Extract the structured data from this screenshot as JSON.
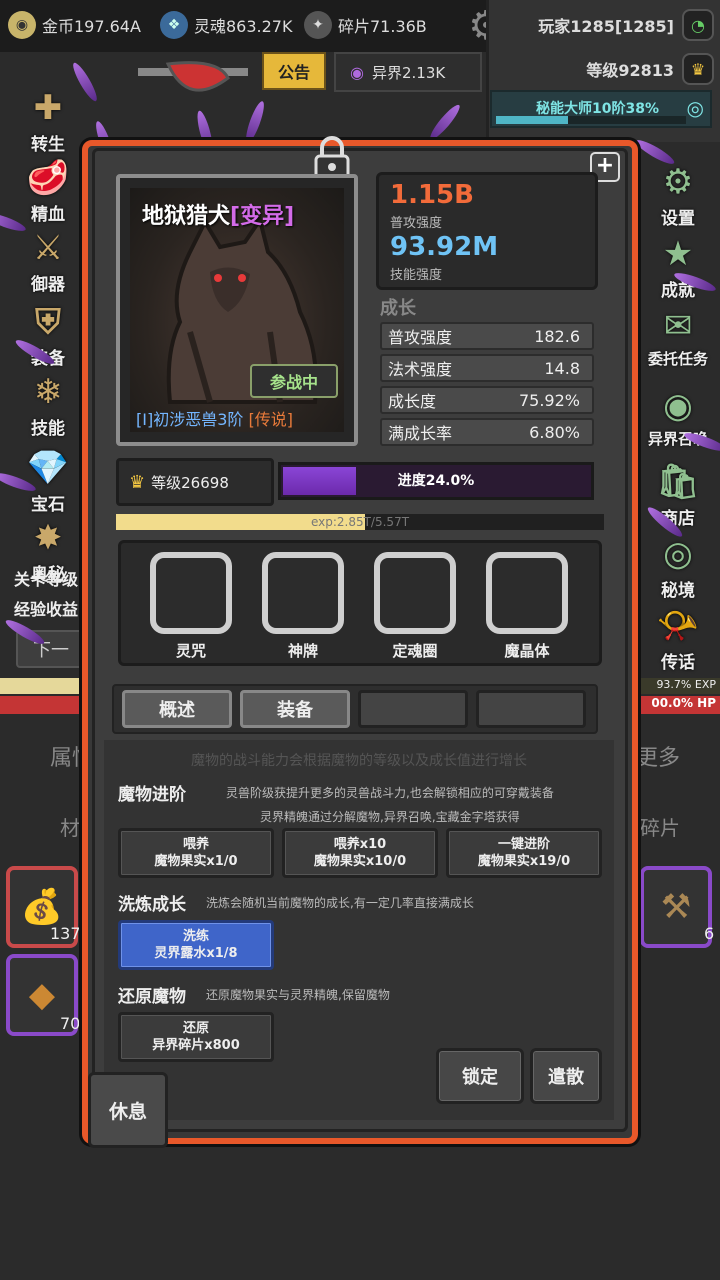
{
  "resources": {
    "gold": "金币197.64A",
    "soul": "灵魂863.27K",
    "shards": "碎片71.36B",
    "otherworld": "异界2.13K"
  },
  "player": {
    "name": "玩家1285[1285]",
    "level": "等级92813",
    "title": "秘能大师10阶38%",
    "title_progress": 0.38
  },
  "notice_label": "公告",
  "left_menu": [
    "转生",
    "精血",
    "御器",
    "装备",
    "技能",
    "宝石",
    "奥秘"
  ],
  "right_menu": [
    "设置",
    "成就",
    "委托任务",
    "异界召唤",
    "商店",
    "秘境",
    "传话"
  ],
  "background": {
    "left_text1": "关卡等级",
    "left_text2": "经验收益",
    "left_btn": "下一",
    "left_tab": "属性",
    "left_tab2": "材",
    "right_exp": "93.7% EXP",
    "right_hp": "00.0% HP",
    "right_tab": "更多",
    "right_tab2": "碎片",
    "inv_count1": "137",
    "inv_count2": "70",
    "inv_count3": "6"
  },
  "monster": {
    "name": "地狱猎犬",
    "mutation": "[变异]",
    "status": "参战中",
    "rank": "[I]初涉恶兽3阶",
    "rarity": "[传说]",
    "attack_value": "1.15B",
    "attack_label": "普攻强度",
    "skill_value": "93.92M",
    "skill_label": "技能强度",
    "growth_title": "成长",
    "growth": [
      {
        "label": "普攻强度",
        "value": "182.6"
      },
      {
        "label": "法术强度",
        "value": "14.8"
      },
      {
        "label": "成长度",
        "value": "75.92%"
      },
      {
        "label": "满成长率",
        "value": "6.80%"
      }
    ],
    "level": "等级26698",
    "progress_text": "进度24.0%",
    "progress": 0.24,
    "exp_text": "exp:2.85T/5.57T",
    "exp_progress": 0.51
  },
  "slots": [
    "灵咒",
    "神牌",
    "定魂圈",
    "魔晶体"
  ],
  "tabs": [
    "概述",
    "装备",
    "",
    ""
  ],
  "overview": {
    "description": "魔物的战斗能力会根据魔物的等级以及成长值进行增长",
    "advance_title": "魔物进阶",
    "advance_desc1": "灵兽阶级获提升更多的灵兽战斗力,也会解锁相应的可穿戴装备",
    "advance_desc2": "灵界精魄通过分解魔物,异界召唤,宝藏金字塔获得",
    "feed_btn": {
      "line1": "喂养",
      "line2": "魔物果实x1/0"
    },
    "feed10_btn": {
      "line1": "喂养x10",
      "line2": "魔物果实x10/0"
    },
    "advance_btn": {
      "line1": "一键进阶",
      "line2": "魔物果实x19/0"
    },
    "refine_title": "洗炼成长",
    "refine_desc": "洗炼会随机当前魔物的成长,有一定几率直接满成长",
    "refine_btn": {
      "line1": "洗练",
      "line2": "灵界露水x1/8"
    },
    "restore_title": "还原魔物",
    "restore_desc": "还原魔物果实与灵界精魄,保留魔物",
    "restore_btn": {
      "line1": "还原",
      "line2": "异界碎片x800"
    },
    "lock_btn": "锁定",
    "release_btn": "遣散",
    "rest_btn": "休息"
  },
  "colors": {
    "dialog_border": "#e8582a",
    "attack": "#f26b3a",
    "skill": "#6fc3f5",
    "progress": "#8a45d6",
    "exp": "#f2dc8c"
  }
}
